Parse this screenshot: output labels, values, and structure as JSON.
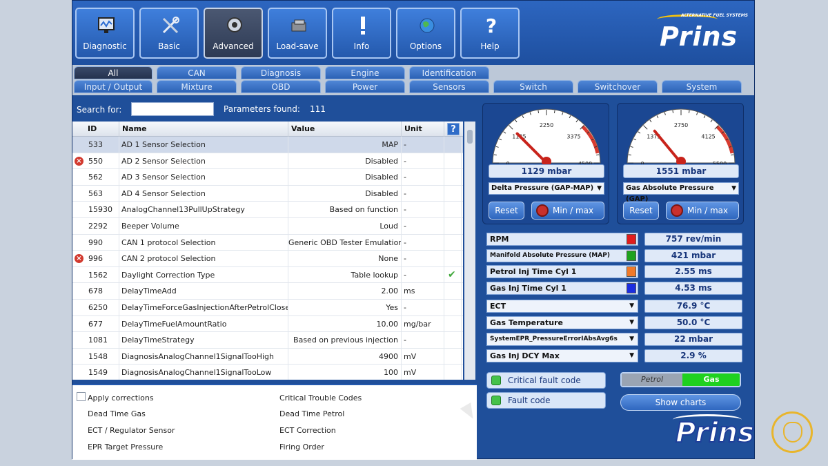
{
  "toolbar": {
    "buttons": [
      {
        "label": "Diagnostic",
        "icon": "monitor-icon"
      },
      {
        "label": "Basic",
        "icon": "tools-icon"
      },
      {
        "label": "Advanced",
        "icon": "speaker-icon",
        "active": true
      },
      {
        "label": "Load-save",
        "icon": "loadsave-icon"
      },
      {
        "label": "Info",
        "icon": "exclamation-icon"
      },
      {
        "label": "Options",
        "icon": "globe-icon"
      },
      {
        "label": "Help",
        "icon": "question-icon"
      }
    ],
    "brand_name": "Prins",
    "brand_tagline": "ALTERNATIVE FUEL SYSTEMS"
  },
  "tabs": {
    "row1": [
      "All",
      "CAN",
      "Diagnosis",
      "Engine",
      "Identification"
    ],
    "row2": [
      "Input / Output",
      "Mixture",
      "OBD",
      "Power",
      "Sensors",
      "Switch",
      "Switchover",
      "System"
    ],
    "selected": "All"
  },
  "search": {
    "label": "Search for:",
    "value": "",
    "found_label": "Parameters found:",
    "found_count": "111"
  },
  "grid": {
    "headers": [
      "ID",
      "Name",
      "Value",
      "Unit"
    ],
    "help_label": "?",
    "rows": [
      {
        "id": "533",
        "name": "AD 1 Sensor Selection",
        "value": "MAP",
        "unit": "-",
        "error": false,
        "check": false,
        "selected": true
      },
      {
        "id": "550",
        "name": "AD 2 Sensor Selection",
        "value": "Disabled",
        "unit": "-",
        "error": true,
        "check": false
      },
      {
        "id": "562",
        "name": "AD 3 Sensor Selection",
        "value": "Disabled",
        "unit": "-",
        "error": false,
        "check": false
      },
      {
        "id": "563",
        "name": "AD 4 Sensor Selection",
        "value": "Disabled",
        "unit": "-",
        "error": false,
        "check": false
      },
      {
        "id": "15930",
        "name": "AnalogChannel13PullUpStrategy",
        "value": "Based on function",
        "unit": "-",
        "error": false,
        "check": false
      },
      {
        "id": "2292",
        "name": "Beeper Volume",
        "value": "Loud",
        "unit": "-",
        "error": false,
        "check": false
      },
      {
        "id": "990",
        "name": "CAN 1 protocol Selection",
        "value": "Generic OBD Tester Emulation",
        "unit": "-",
        "error": false,
        "check": false
      },
      {
        "id": "996",
        "name": "CAN 2 protocol Selection",
        "value": "None",
        "unit": "-",
        "error": true,
        "check": false
      },
      {
        "id": "1562",
        "name": "Daylight Correction Type",
        "value": "Table lookup",
        "unit": "-",
        "error": false,
        "check": true
      },
      {
        "id": "678",
        "name": "DelayTimeAdd",
        "value": "2.00",
        "unit": "ms",
        "error": false,
        "check": false
      },
      {
        "id": "6250",
        "name": "DelayTimeForceGasInjectionAfterPetrolClose",
        "value": "Yes",
        "unit": "-",
        "error": false,
        "check": false
      },
      {
        "id": "677",
        "name": "DelayTimeFuelAmountRatio",
        "value": "10.00",
        "unit": "mg/bar",
        "error": false,
        "check": false
      },
      {
        "id": "1081",
        "name": "DelayTimeStrategy",
        "value": "Based on previous injection",
        "unit": "-",
        "error": false,
        "check": false
      },
      {
        "id": "1548",
        "name": "DiagnosisAnalogChannel1SignalTooHigh",
        "value": "4900",
        "unit": "mV",
        "error": false,
        "check": false
      },
      {
        "id": "1549",
        "name": "DiagnosisAnalogChannel1SignalTooLow",
        "value": "100",
        "unit": "mV",
        "error": false,
        "check": false
      }
    ]
  },
  "subpanel": {
    "items": [
      "Apply corrections",
      "Critical Trouble Codes",
      "Dead Time Gas",
      "Dead Time Petrol",
      "ECT / Regulator Sensor",
      "ECT Correction",
      "EPR Target Pressure",
      "Firing Order"
    ]
  },
  "gauges": [
    {
      "ticks": [
        "0",
        "1125",
        "2250",
        "3375",
        "4500"
      ],
      "readout": "1129 mbar",
      "select": "Delta Pressure (GAP-MAP)",
      "level_fraction": 0.25,
      "reset_label": "Reset",
      "minmax_label": "Min / max"
    },
    {
      "ticks": [
        "0",
        "1375",
        "2750",
        "4125",
        "5500"
      ],
      "readout": "1551 mbar",
      "select": "Gas Absolute Pressure (GAP)",
      "level_fraction": 0.28,
      "reset_label": "Reset",
      "minmax_label": "Min / max"
    }
  ],
  "params": [
    {
      "label": "RPM",
      "value": "757 rev/min",
      "kind": "swatch",
      "color": "#e11d1d"
    },
    {
      "label": "Manifold Absolute Pressure (MAP)",
      "value": "421 mbar",
      "kind": "swatch",
      "color": "#1ea21e"
    },
    {
      "label": "Petrol Inj Time Cyl 1",
      "value": "2.55 ms",
      "kind": "swatch",
      "color": "#f07a2a"
    },
    {
      "label": "Gas Inj Time Cyl 1",
      "value": "4.53 ms",
      "kind": "swatch",
      "color": "#1c2ee0"
    },
    {
      "label": "ECT",
      "value": "76.9 °C",
      "kind": "dropdown"
    },
    {
      "label": "Gas Temperature",
      "value": "50.0 °C",
      "kind": "dropdown"
    },
    {
      "label": "SystemEPR_PressureErrorIAbsAvg6s",
      "value": "22 mbar",
      "kind": "dropdown"
    },
    {
      "label": "Gas Inj DCY Max",
      "value": "2.9 %",
      "kind": "dropdown"
    }
  ],
  "status": {
    "critical_label": "Critical fault code",
    "fault_label": "Fault code",
    "petrol_label": "Petrol",
    "gas_label": "Gas",
    "charts_label": "Show charts"
  },
  "watermark": {
    "name": "Prins"
  }
}
